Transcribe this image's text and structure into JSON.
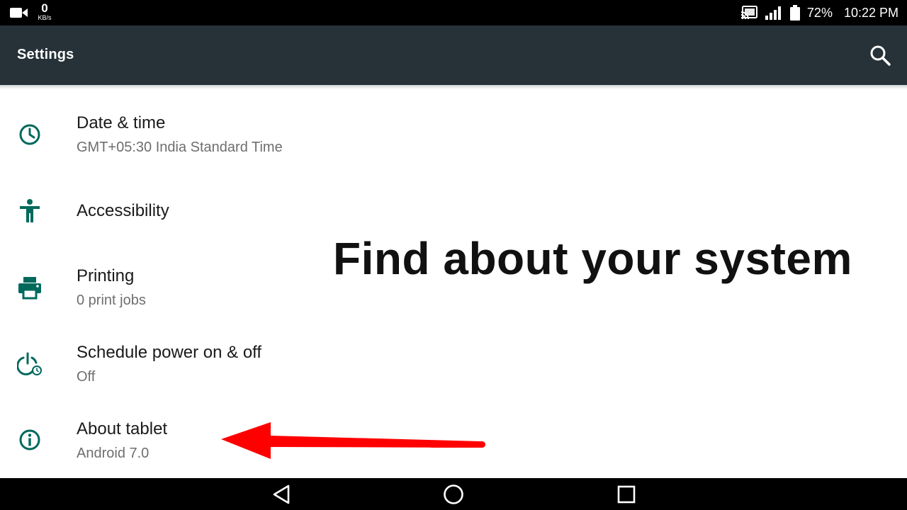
{
  "status_bar": {
    "net_speed_value": "0",
    "net_speed_unit": "KB/s",
    "battery": "72%",
    "time": "10:22 PM",
    "icons": [
      "video-camera-icon",
      "cast-icon",
      "signal-icon",
      "battery-icon"
    ]
  },
  "app_bar": {
    "title": "Settings",
    "search_icon": "search-icon"
  },
  "settings_items": [
    {
      "title": "Date & time",
      "summary": "GMT+05:30 India Standard Time",
      "icon": "clock-icon"
    },
    {
      "title": "Accessibility",
      "summary": "",
      "icon": "accessibility-icon"
    },
    {
      "title": "Printing",
      "summary": "0 print jobs",
      "icon": "printer-icon"
    },
    {
      "title": "Schedule power on & off",
      "summary": "Off",
      "icon": "power-schedule-icon"
    },
    {
      "title": "About tablet",
      "summary": "Android 7.0",
      "icon": "info-icon"
    }
  ],
  "overlay": {
    "caption": "Find about your system",
    "arrow_color": "#ff0000"
  },
  "nav_bar": {
    "icons": [
      "back-icon",
      "home-icon",
      "recents-icon"
    ]
  },
  "colors": {
    "app_bar": "#263238",
    "icon_accent": "#00695c",
    "status_bar": "#000000"
  }
}
